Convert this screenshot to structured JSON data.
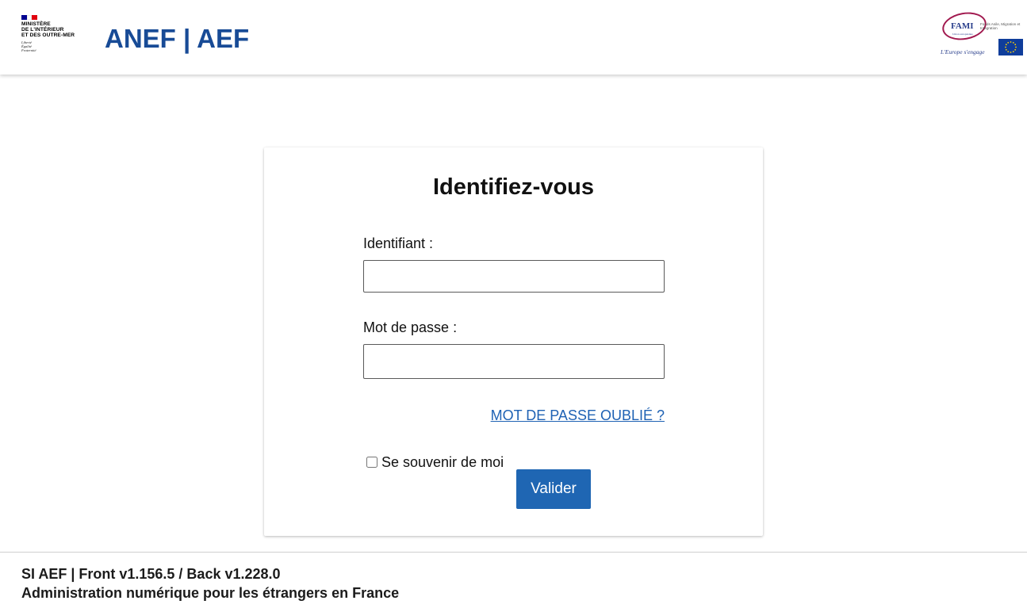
{
  "header": {
    "ministry_name_lines": [
      "MINISTÈRE",
      "DE L'INTÉRIEUR",
      "ET DES OUTRE-MER"
    ],
    "motto_lines": [
      "Liberté",
      "Égalité",
      "Fraternité"
    ],
    "app_title": "ANEF | AEF",
    "fami_logo": {
      "acronym": "FAMI",
      "subtitle": "Union européenne",
      "description": "Fonds Asile, Migration et Intégration",
      "slogan": "L'Europe s'engage"
    }
  },
  "login": {
    "title": "Identifiez-vous",
    "identifier_label": "Identifiant :",
    "identifier_value": "",
    "password_label": "Mot de passe :",
    "password_value": "",
    "forgot_password_link": "MOT DE PASSE OUBLIÉ ?",
    "remember_me_label": "Se souvenir de moi",
    "remember_me_checked": false,
    "submit_label": "Valider"
  },
  "footer": {
    "version_line": "SI AEF | Front v1.156.5 / Back v1.228.0",
    "description_line": "Administration numérique pour les étrangers en France"
  },
  "colors": {
    "brand_blue": "#184b96",
    "button_blue": "#1f66b3",
    "link_blue": "#1f62b4",
    "fami_magenta": "#a1194f",
    "eu_blue": "#0f3d9b",
    "flag_blue": "#000091",
    "flag_red": "#e1000f"
  }
}
